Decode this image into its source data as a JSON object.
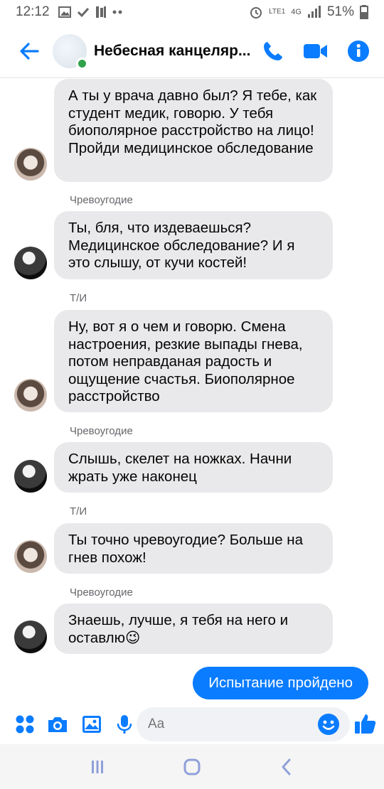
{
  "status_bar": {
    "time": "12:12",
    "battery": "51%",
    "network": "4G",
    "carrier_tag": "LTE1"
  },
  "header": {
    "title": "Небесная канцеляр...",
    "online": true,
    "accent": "#0a7cff"
  },
  "messages": [
    {
      "sender": "",
      "text": "А ты у врача давно был? Я тебе, как студент медик, говорю. У тебя биополярное расстройство на лицо! Пройди медицинское обследование",
      "avatar": "girl"
    },
    {
      "sender": "Чревоугодие",
      "text": "Ты, бля, что издеваешься? Медицинское обследование? И я это слышу, от кучи костей!",
      "avatar": "boy"
    },
    {
      "sender": "Т/И",
      "text": "Ну, вот я о чем и говорю. Смена настроения, резкие выпады гнева, потом неправданая радость и ощущение счастья. Биополярное расстройство",
      "avatar": "girl"
    },
    {
      "sender": "Чревоугодие",
      "text": "Слышь, скелет на ножках. Начни жрать уже наконец",
      "avatar": "boy"
    },
    {
      "sender": "Т/И",
      "text": "Ты точно чревоугодие? Больше на гнев похож!",
      "avatar": "girl"
    },
    {
      "sender": "Чревоугодие",
      "text": "Знаешь, лучше, я тебя на него и оставлю😉",
      "avatar": "boy"
    }
  ],
  "outgoing_message": "Испытание пройдено",
  "composer": {
    "placeholder": "Aa"
  },
  "icons": {
    "back": "back-arrow-icon",
    "call": "phone-icon",
    "video": "video-camera-icon",
    "info": "info-icon",
    "apps": "apps-grid-icon",
    "camera": "camera-icon",
    "gallery": "image-icon",
    "mic": "microphone-icon",
    "emoji": "emoji-icon",
    "like": "thumbs-up-icon"
  }
}
